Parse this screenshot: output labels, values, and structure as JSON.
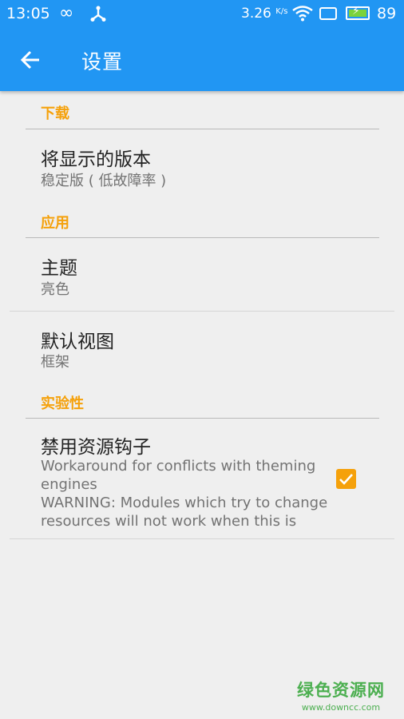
{
  "status_bar": {
    "time": "13:05",
    "infinity_glyph": "∞",
    "net_speed": "3.26",
    "net_speed_unit": "K/s",
    "battery_percent": "89"
  },
  "app_bar": {
    "title": "设置",
    "back_icon": "arrow-back-icon"
  },
  "categories": [
    {
      "header": "下载"
    },
    {
      "header": "应用"
    },
    {
      "header": "实验性"
    }
  ],
  "preferences": [
    {
      "title": "将显示的版本",
      "summary": "稳定版 ( 低故障率 )"
    },
    {
      "title": "主题",
      "summary": "亮色"
    },
    {
      "title": "默认视图",
      "summary": "框架"
    },
    {
      "title": "禁用资源钩子",
      "summary": "Workaround for conflicts with theming engines\nWARNING: Modules which try to change resources will not work when this is",
      "checked": true
    }
  ],
  "watermark": {
    "main": "绿色资源网",
    "sub": "www.downcc.com"
  },
  "colors": {
    "primary": "#2196f3",
    "accent": "#f5a10b",
    "background": "#efefef"
  }
}
